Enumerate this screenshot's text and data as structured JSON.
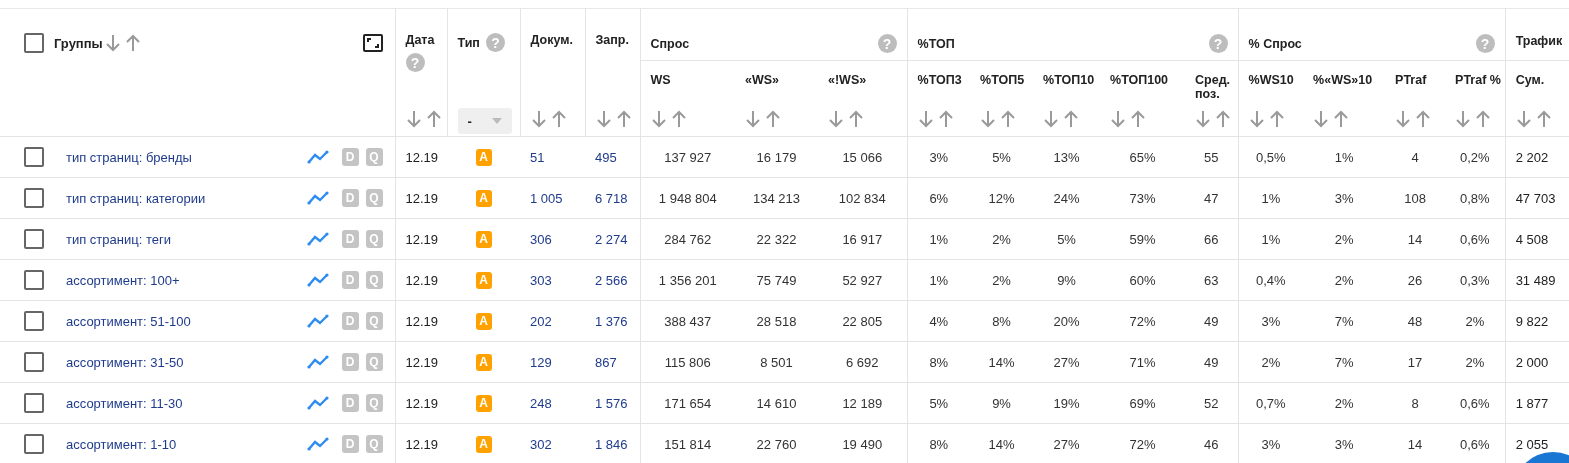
{
  "table": {
    "groups_header": {
      "label": "Группы",
      "checked": false
    },
    "columns": [
      {
        "label": "Дата",
        "help": "?"
      },
      {
        "label": "Тип",
        "help": "?",
        "filter": "-"
      },
      {
        "label": "Докум."
      },
      {
        "label": "Запр."
      }
    ],
    "column_groups": [
      {
        "label": "Спрос",
        "help": "?",
        "columns": [
          "WS",
          "«WS»",
          "«!WS»"
        ]
      },
      {
        "label": "%ТОП",
        "help": "?",
        "columns": [
          "%ТОП3",
          "%ТОП5",
          "%ТОП10",
          "%ТОП100",
          "Сред. поз."
        ]
      },
      {
        "label": "% Спрос",
        "help": "?",
        "columns": [
          "%WS10",
          "%«WS»10",
          "PTraf",
          "PTraf %"
        ]
      },
      {
        "label": "Трафик",
        "columns": [
          "Сум."
        ]
      }
    ],
    "rows": [
      {
        "checked": false,
        "name": "тип страниц: бренды",
        "actions": [
          "D",
          "Q"
        ],
        "date": "12.19",
        "type": "A",
        "docs": "51",
        "queries": "495",
        "values": [
          "137 927",
          "16 179",
          "15 066",
          "3%",
          "5%",
          "13%",
          "65%",
          "55",
          "0,5%",
          "1%",
          "4",
          "0,2%",
          "2 202"
        ]
      },
      {
        "checked": false,
        "name": "тип страниц: категории",
        "actions": [
          "D",
          "Q"
        ],
        "date": "12.19",
        "type": "A",
        "docs": "1 005",
        "queries": "6 718",
        "values": [
          "1 948 804",
          "134 213",
          "102 834",
          "6%",
          "12%",
          "24%",
          "73%",
          "47",
          "1%",
          "3%",
          "108",
          "0,8%",
          "47 703"
        ]
      },
      {
        "checked": false,
        "name": "тип страниц: теги",
        "actions": [
          "D",
          "Q"
        ],
        "date": "12.19",
        "type": "A",
        "docs": "306",
        "queries": "2 274",
        "values": [
          "284 762",
          "22 322",
          "16 917",
          "1%",
          "2%",
          "5%",
          "59%",
          "66",
          "1%",
          "2%",
          "14",
          "0,6%",
          "4 508"
        ]
      },
      {
        "checked": false,
        "name": "ассортимент: 100+",
        "actions": [
          "D",
          "Q"
        ],
        "date": "12.19",
        "type": "A",
        "docs": "303",
        "queries": "2 566",
        "values": [
          "1 356 201",
          "75 749",
          "52 927",
          "1%",
          "2%",
          "9%",
          "60%",
          "63",
          "0,4%",
          "2%",
          "26",
          "0,3%",
          "31 489"
        ]
      },
      {
        "checked": false,
        "name": "ассортимент: 51-100",
        "actions": [
          "D",
          "Q"
        ],
        "date": "12.19",
        "type": "A",
        "docs": "202",
        "queries": "1 376",
        "values": [
          "388 437",
          "28 518",
          "22 805",
          "4%",
          "8%",
          "20%",
          "72%",
          "49",
          "3%",
          "7%",
          "48",
          "2%",
          "9 822"
        ]
      },
      {
        "checked": false,
        "name": "ассортимент: 31-50",
        "actions": [
          "D",
          "Q"
        ],
        "date": "12.19",
        "type": "A",
        "docs": "129",
        "queries": "867",
        "values": [
          "115 806",
          "8 501",
          "6 692",
          "8%",
          "14%",
          "27%",
          "71%",
          "49",
          "2%",
          "7%",
          "17",
          "2%",
          "2 000"
        ]
      },
      {
        "checked": false,
        "name": "ассортимент: 11-30",
        "actions": [
          "D",
          "Q"
        ],
        "date": "12.19",
        "type": "A",
        "docs": "248",
        "queries": "1 576",
        "values": [
          "171 654",
          "14 610",
          "12 189",
          "5%",
          "9%",
          "19%",
          "69%",
          "52",
          "0,7%",
          "2%",
          "8",
          "0,6%",
          "1 877"
        ]
      },
      {
        "checked": false,
        "name": "ассортимент: 1-10",
        "actions": [
          "D",
          "Q"
        ],
        "date": "12.19",
        "type": "A",
        "docs": "302",
        "queries": "1 846",
        "values": [
          "151 814",
          "22 760",
          "19 490",
          "8%",
          "14%",
          "27%",
          "72%",
          "46",
          "3%",
          "3%",
          "14",
          "0,6%",
          "2 055"
        ]
      }
    ]
  }
}
